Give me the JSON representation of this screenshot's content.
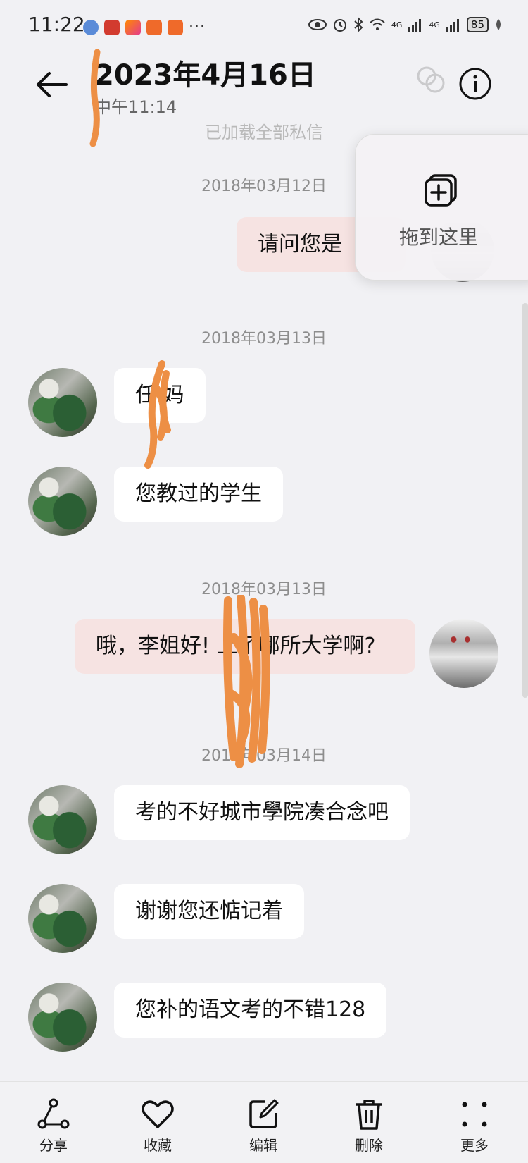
{
  "status_bar": {
    "time": "11:22",
    "app_icons": [
      "browser-icon",
      "app-icon-red",
      "video-app-icon",
      "app-icon-orange",
      "app-icon-orange"
    ],
    "more_dots": "···",
    "network_1": "4G",
    "network_2": "4G",
    "battery": "85"
  },
  "header": {
    "title": "2023年4月16日",
    "subtitle": "中午11:14"
  },
  "loaded_note": "已加载全部私信",
  "drag_target": {
    "label": "拖到这里"
  },
  "messages": {
    "date_1": "2018年03月12日",
    "msg_1": "请问您是",
    "date_2": "2018年03月13日",
    "msg_2": "任  妈",
    "msg_3": "您教过的学生",
    "date_3": "2018年03月13日",
    "msg_4": "哦，李姐好!   上了哪所大学啊?",
    "date_4": "2018年03月14日",
    "msg_5": "考的不好城市學院凑合念吧",
    "msg_6": "谢谢您还惦记着",
    "msg_7": "您补的语文考的不错128"
  },
  "bottom_bar": {
    "share": "分享",
    "favorite": "收藏",
    "edit": "编辑",
    "delete": "删除",
    "more": "更多"
  }
}
